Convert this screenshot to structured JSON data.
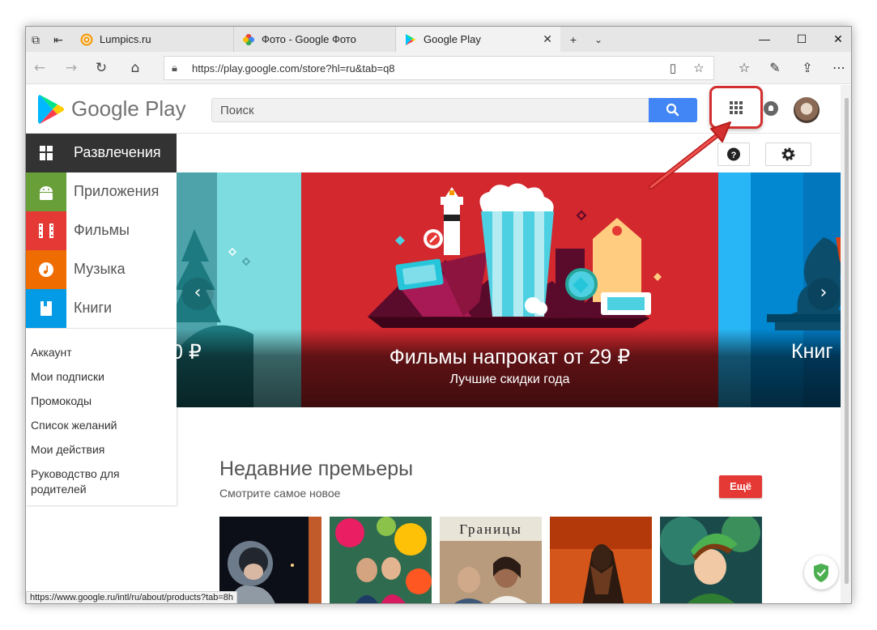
{
  "tabs": [
    {
      "title": "Lumpics.ru"
    },
    {
      "title": "Фото - Google Фото"
    },
    {
      "title": "Google Play"
    }
  ],
  "address": {
    "url": "https://play.google.com/store?hl=ru&tab=q8"
  },
  "header": {
    "logo_text": "Google Play",
    "search_placeholder": "Поиск"
  },
  "sidebar": {
    "categories": [
      {
        "label": "Развлечения",
        "color": "#333333"
      },
      {
        "label": "Приложения",
        "color": "#689f38"
      },
      {
        "label": "Фильмы",
        "color": "#e53935"
      },
      {
        "label": "Музыка",
        "color": "#ef6c00"
      },
      {
        "label": "Книги",
        "color": "#039be5"
      }
    ],
    "links": [
      "Аккаунт",
      "Мои подписки",
      "Промокоды",
      "Список желаний",
      "Мои действия",
      "Руководство для родителей"
    ]
  },
  "carousel": {
    "left_text": "0 ₽",
    "title": "Фильмы напрокат от 29 ₽",
    "subtitle": "Лучшие скидки года",
    "right_text": "Книг"
  },
  "section": {
    "title": "Недавние премьеры",
    "subtitle": "Смотрите самое новое",
    "more_label": "Ещё",
    "poster_title": "Границы"
  },
  "status_bar": {
    "url": "https://www.google.ru/intl/ru/about/products?tab=8h"
  }
}
